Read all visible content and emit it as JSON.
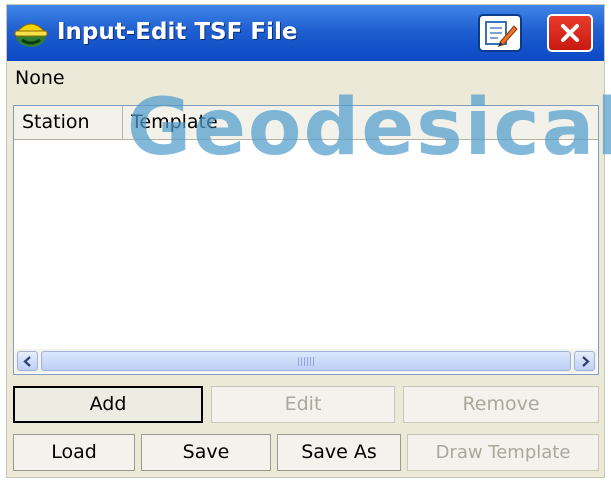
{
  "window": {
    "title": "Input-Edit TSF File"
  },
  "file_label": "None",
  "watermark": "Geodesical",
  "list": {
    "columns": [
      "Station",
      "Template"
    ],
    "rows": []
  },
  "buttons": {
    "add": "Add",
    "edit": "Edit",
    "remove": "Remove",
    "load": "Load",
    "save": "Save",
    "save_as": "Save As",
    "draw_template": "Draw Template"
  },
  "icons": {
    "app": "helmet-icon",
    "edit": "edit-pencil-icon",
    "close": "close-icon",
    "scroll_left": "arrow-left-icon",
    "scroll_right": "arrow-right-icon"
  },
  "colors": {
    "titlebar": "#1f5fd0",
    "close": "#d42a1c",
    "watermark": "#4e9ccd"
  }
}
